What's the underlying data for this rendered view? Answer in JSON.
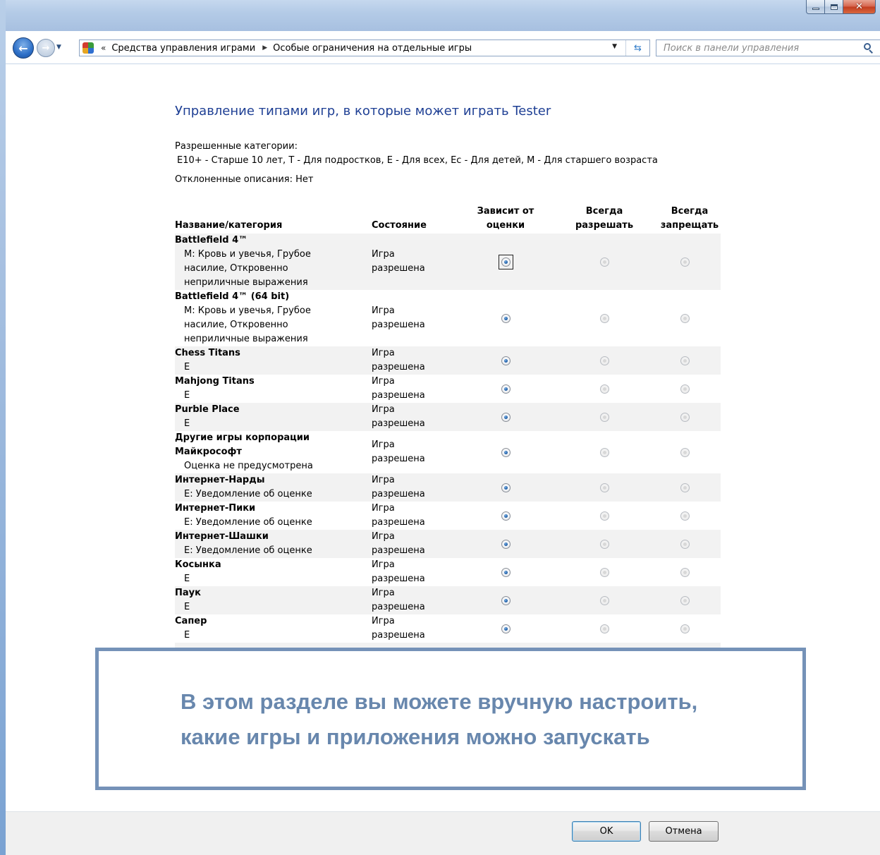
{
  "window": {
    "address_chevron": "«",
    "breadcrumbs": [
      "Средства управления играми",
      "Особые ограничения на отдельные игры"
    ],
    "search_placeholder": "Поиск в панели управления"
  },
  "content": {
    "heading": "Управление типами игр, в которые может играть Tester",
    "allowed_label": "Разрешенные категории:",
    "allowed_values": "E10+ - Старше 10 лет, T - Для подростков, E - Для всех, Ec - Для детей, M - Для старшего возраста",
    "rejected": "Отклоненные описания:  Нет"
  },
  "table": {
    "headers": {
      "name": "Название/категория",
      "state": "Состояние",
      "rating": "Зависит от\nоценки",
      "allow": "Всегда\nразрешать",
      "block": "Всегда\nзапрещать"
    },
    "rows": [
      {
        "name": "Battlefield 4™",
        "desc": "M: Кровь и увечья, Грубое\nнасилие, Откровенно\nнеприличные выражения",
        "state": "Игра\nразрешена",
        "selected": "rating"
      },
      {
        "name": "Battlefield 4™ (64 bit)",
        "desc": "M: Кровь и увечья, Грубое\nнасилие, Откровенно\nнеприличные выражения",
        "state": "Игра\nразрешена",
        "selected": "rating"
      },
      {
        "name": "Chess Titans",
        "desc": "E",
        "state": "Игра\nразрешена",
        "selected": "rating"
      },
      {
        "name": "Mahjong Titans",
        "desc": "E",
        "state": "Игра\nразрешена",
        "selected": "rating"
      },
      {
        "name": "Purble Place",
        "desc": "E",
        "state": "Игра\nразрешена",
        "selected": "rating"
      },
      {
        "name": "Другие игры корпорации\nМайкрософт",
        "desc": "Оценка не предусмотрена",
        "state": "Игра\nразрешена",
        "selected": "rating"
      },
      {
        "name": "Интернет-Нарды",
        "desc": "E: Уведомление об оценке",
        "state": "Игра\nразрешена",
        "selected": "rating"
      },
      {
        "name": "Интернет-Пики",
        "desc": "E: Уведомление об оценке",
        "state": "Игра\nразрешена",
        "selected": "rating"
      },
      {
        "name": "Интернет-Шашки",
        "desc": "E: Уведомление об оценке",
        "state": "Игра\nразрешена",
        "selected": "rating"
      },
      {
        "name": "Косынка",
        "desc": "E",
        "state": "Игра\nразрешена",
        "selected": "rating"
      },
      {
        "name": "Паук",
        "desc": "E",
        "state": "Игра\nразрешена",
        "selected": "rating"
      },
      {
        "name": "Сапер",
        "desc": "E",
        "state": "Игра\nразрешена",
        "selected": "rating"
      }
    ]
  },
  "callout": {
    "line1": "В этом разделе вы можете вручную настроить,",
    "line2": "какие игры и приложения можно запускать"
  },
  "footer": {
    "ok_label": "OK",
    "cancel_label": "Отмена"
  },
  "colors": {
    "heading": "#1e3f94",
    "callout_border": "#7592b8",
    "callout_text": "#6887ad",
    "row_alt": "#f2f2f2"
  }
}
